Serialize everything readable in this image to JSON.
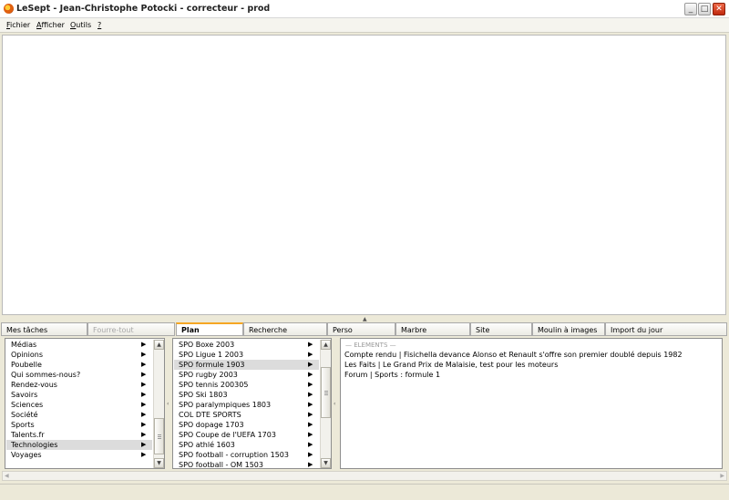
{
  "window": {
    "title": "LeSept - Jean-Christophe Potocki - correcteur - prod",
    "minimize_glyph": "_",
    "maximize_glyph": "□",
    "close_glyph": "✕"
  },
  "menu": {
    "items": [
      {
        "accel": "F",
        "rest": "ichier"
      },
      {
        "accel": "A",
        "rest": "fficher"
      },
      {
        "accel": "O",
        "rest": "utils"
      },
      {
        "accel": "?",
        "rest": ""
      }
    ]
  },
  "splitter": {
    "grip_glyph": "▲"
  },
  "tabs": [
    {
      "label": "Mes tâches",
      "state": "normal"
    },
    {
      "label": "Fourre-tout",
      "state": "disabled"
    },
    {
      "label": "Plan",
      "state": "active"
    },
    {
      "label": "Recherche",
      "state": "normal"
    },
    {
      "label": "Perso",
      "state": "normal"
    },
    {
      "label": "Marbre",
      "state": "normal"
    },
    {
      "label": "Site",
      "state": "normal"
    },
    {
      "label": "Moulin à images",
      "state": "normal"
    },
    {
      "label": "Import du jour",
      "state": "normal"
    }
  ],
  "sections_list": {
    "arrow_glyph": "▶",
    "selected_index": 10,
    "items": [
      "Médias",
      "Opinions",
      "Poubelle",
      "Qui sommes-nous?",
      "Rendez-vous",
      "Savoirs",
      "Sciences",
      "Société",
      "Sports",
      "Talents.fr",
      "Technologies",
      "Voyages"
    ]
  },
  "plan_list": {
    "arrow_glyph": "▶",
    "selected_index": 2,
    "items": [
      "SPO Boxe 2003",
      "SPO Ligue 1 2003",
      "SPO formule 1903",
      "SPO rugby 2003",
      "SPO tennis 200305",
      "SPO Ski 1803",
      "SPO paralympiques 1803",
      "COL DTE SPORTS",
      "SPO dopage 1703",
      "SPO Coupe de l'UEFA 1703",
      "SPO athlé 1603",
      "SPO football - corruption 1503",
      "SPO football - OM 1503"
    ]
  },
  "elements": {
    "legend": "— ELEMENTS —",
    "rows": [
      "Compte rendu | Fisichella devance Alonso et Renault s'offre son premier doublé depuis 1982",
      "Les Faits | Le Grand Prix de Malaisie, test pour les moteurs",
      "Forum | Sports : formule 1"
    ]
  },
  "scrollbar": {
    "up_glyph": "▲",
    "down_glyph": "▼",
    "left_glyph": "◀",
    "right_glyph": "▶"
  }
}
